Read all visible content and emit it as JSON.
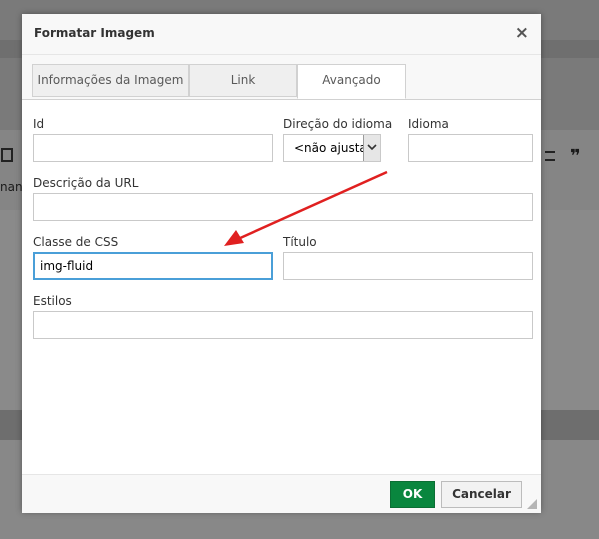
{
  "dialog": {
    "title": "Formatar Imagem",
    "close_symbol": "×",
    "tabs": [
      {
        "label": "Informações da Imagem",
        "active": false
      },
      {
        "label": "Link",
        "active": false
      },
      {
        "label": "Avançado",
        "active": true
      }
    ]
  },
  "form": {
    "id": {
      "label": "Id",
      "value": ""
    },
    "direction": {
      "label": "Direção do idioma",
      "value": "<não ajustado>"
    },
    "language": {
      "label": "Idioma",
      "value": ""
    },
    "url_description": {
      "label": "Descrição da URL",
      "value": ""
    },
    "css_class": {
      "label": "Classe de CSS",
      "value": "img-fluid"
    },
    "title": {
      "label": "Título",
      "value": ""
    },
    "styles": {
      "label": "Estilos",
      "value": ""
    }
  },
  "footer": {
    "ok_label": "OK",
    "cancel_label": "Cancelar"
  },
  "background": {
    "quote_glyph": "❞",
    "partial_text": "nanh"
  },
  "colors": {
    "ok_button": "#09863e",
    "focus_border": "#4a9fd8",
    "annotation_arrow": "#e02020"
  }
}
